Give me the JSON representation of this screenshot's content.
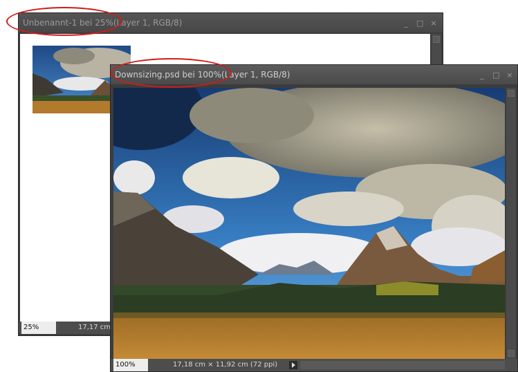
{
  "back_window": {
    "title": "Unbenannt-1 bei 25%(Layer 1, RGB/8)",
    "zoom": "25%",
    "dimensions": "17,17 cm"
  },
  "front_window": {
    "title": "Downsizing.psd bei 100%(Layer 1, RGB/8)",
    "zoom": "100%",
    "dimensions": "17,18 cm × 11,92 cm (72 ppi)"
  },
  "window_controls": {
    "minimize": "_",
    "maximize": "□",
    "close": "×"
  },
  "icons": [
    "minimize-icon",
    "maximize-icon",
    "close-icon",
    "status-menu-arrow-icon",
    "scroll-up-arrow-icon",
    "scroll-down-arrow-icon"
  ],
  "colors": {
    "highlight_ellipse": "#d21a1a",
    "titlebar": "#4f4f4f",
    "status_bar": "#4d4d4d"
  }
}
